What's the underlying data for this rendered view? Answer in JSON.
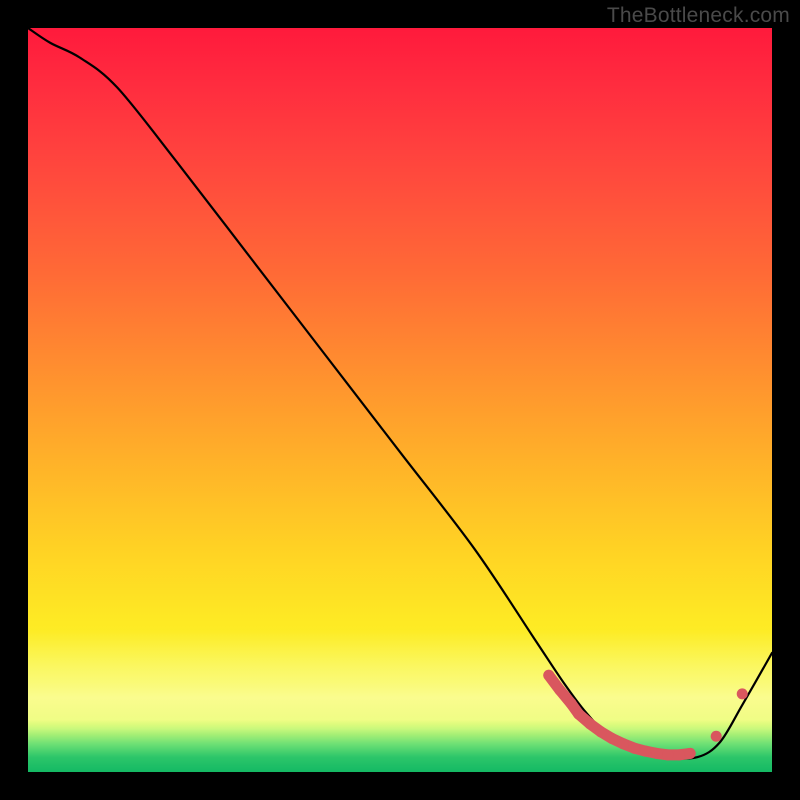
{
  "watermark": "TheBottleneck.com",
  "chart_data": {
    "type": "line",
    "title": "",
    "xlabel": "",
    "ylabel": "",
    "x_range": [
      0,
      100
    ],
    "y_range": [
      0,
      100
    ],
    "series": [
      {
        "name": "curve",
        "x": [
          0,
          3,
          7,
          12,
          20,
          30,
          40,
          50,
          60,
          68,
          72,
          75,
          78,
          82,
          86,
          90,
          93,
          96,
          100
        ],
        "y": [
          100,
          98,
          96,
          92,
          82,
          69,
          56,
          43,
          30,
          18,
          12,
          8,
          5,
          3,
          2,
          2,
          4,
          9,
          16
        ]
      }
    ],
    "markers": {
      "name": "cluster",
      "color": "#d9575e",
      "points_x": [
        70,
        71.5,
        73,
        74,
        75.5,
        77,
        78.5,
        80,
        81.5,
        83,
        84.5,
        86,
        87.5,
        89,
        92.5,
        96
      ],
      "points_y": [
        13,
        11,
        9.2,
        7.8,
        6.5,
        5.4,
        4.5,
        3.8,
        3.2,
        2.8,
        2.5,
        2.3,
        2.3,
        2.5,
        4.8,
        10.5
      ]
    },
    "background_gradient": {
      "top": "#ff1a3c",
      "mid": "#ffd224",
      "low": "#eefc55",
      "bottom_band": "#1fba66"
    }
  }
}
